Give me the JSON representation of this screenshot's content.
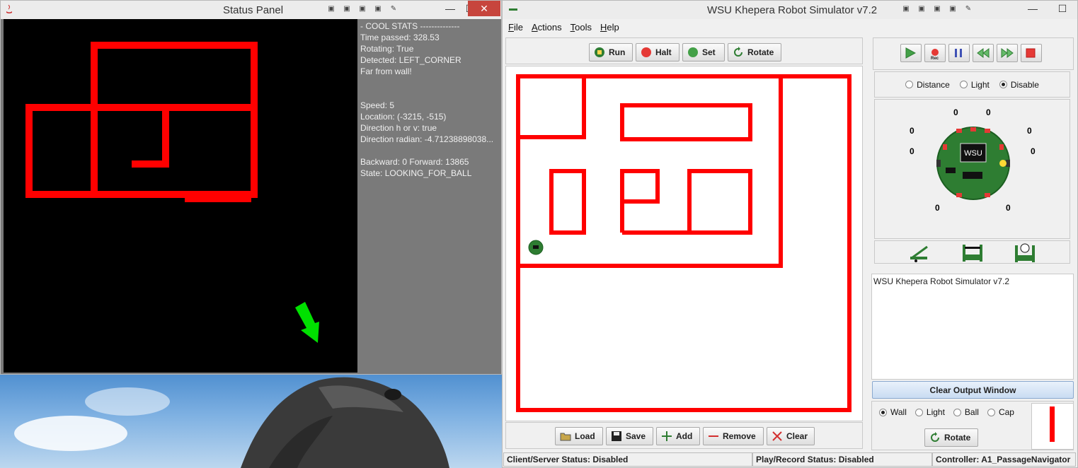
{
  "status_window": {
    "title": "Status Panel",
    "stats": {
      "header": "- COOL STATS --------------",
      "time": "Time passed: 328.53",
      "rotating": "Rotating: True",
      "detected": "Detected: LEFT_CORNER",
      "wall": "Far from wall!",
      "speed": "Speed: 5",
      "location": "Location: (-3215, -515)",
      "direction": "Direction h or v: true",
      "radian": "Direction radian: -4.71238898038...",
      "movement": "Backward: 0 Forward: 13865",
      "state": "State: LOOKING_FOR_BALL"
    },
    "colors": {
      "map": "#ff0000",
      "arrow": "#00ff00",
      "background": "#000000"
    }
  },
  "sim_window": {
    "title": "WSU Khepera Robot Simulator v7.2",
    "menu": [
      "File",
      "Actions",
      "Tools",
      "Help"
    ],
    "toolbar": {
      "run": "Run",
      "halt": "Halt",
      "set": "Set",
      "rotate": "Rotate"
    },
    "edit_bar": {
      "load": "Load",
      "save": "Save",
      "add": "Add",
      "remove": "Remove",
      "clear": "Clear"
    },
    "sensor_mode": {
      "options": [
        "Distance",
        "Light",
        "Disable"
      ],
      "selected": "Disable"
    },
    "sensor_readings": [
      "0",
      "0",
      "0",
      "0",
      "0",
      "0",
      "0",
      "0"
    ],
    "robot_label": "WSU",
    "output_text": "WSU Khepera Robot Simulator v7.2",
    "clear_output": "Clear Output Window",
    "place_mode": {
      "options": [
        "Wall",
        "Light",
        "Ball",
        "Cap"
      ],
      "selected": "Wall"
    },
    "place_rotate": "Rotate",
    "status": {
      "client": "Client/Server Status: Disabled",
      "play": "Play/Record Status: Disabled",
      "controller": "Controller: A1_PassageNavigator"
    },
    "colors": {
      "wall": "#ff0000",
      "robot": "#2e7d32"
    }
  }
}
